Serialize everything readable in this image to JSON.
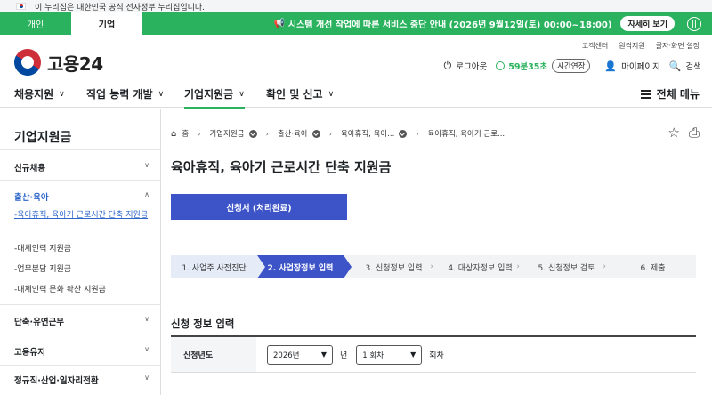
{
  "gov_banner": {
    "text": "이 누리집은 대한민국 공식 전자정부 누리집입니다."
  },
  "user_tabs": [
    {
      "label": "개인",
      "active": false
    },
    {
      "label": "기업",
      "active": true
    }
  ],
  "notice": {
    "text": "시스템 개선 작업에 따른 서비스 중단 안내 (2026년 9월12일(토) 00:00~18:00)",
    "detail_label": "자세히 보기",
    "icon": "megaphone-icon"
  },
  "util_links": [
    "고객센터",
    "원격지원",
    "글자·화면 설정"
  ],
  "logo": {
    "text": "고용24"
  },
  "header": {
    "logout": "로그아웃",
    "timer": "59분35초",
    "extend": "시간연장",
    "mypage": "마이페이지",
    "search": "검색"
  },
  "main_nav": [
    {
      "label": "채용지원",
      "active": false
    },
    {
      "label": "직업 능력 개발",
      "active": false
    },
    {
      "label": "기업지원금",
      "active": true
    },
    {
      "label": "확인 및 신고",
      "active": false
    }
  ],
  "all_menu": "전체 메뉴",
  "sidebar": {
    "title": "기업지원금",
    "sections": [
      {
        "label": "신규채용"
      },
      {
        "label": "출산·육아"
      },
      {
        "label": "단축·유연근무"
      },
      {
        "label": "고용유지"
      },
      {
        "label": "정규직·산업·일자리전환"
      }
    ],
    "sub_items": [
      "-육아휴직, 육아기 근로시간 단축 지원금",
      "-대체인력 지원금",
      "-업무분담 지원금",
      "-대체인력 문화 확산 지원금"
    ]
  },
  "breadcrumb": [
    "홈",
    "기업지원금",
    "출산·육아",
    "육아휴직, 육아...",
    "육아휴직, 육아기 근로..."
  ],
  "page_title": "육아휴직, 육아기 근로시간 단축 지원금",
  "apply_button": "신청서 (처리완료)",
  "steps": [
    "1. 사업주 사전진단",
    "2. 사업장정보 입력",
    "3. 신청정보 입력",
    "4. 대상자정보 입력",
    "5. 신청정보 검토",
    "6. 제출"
  ],
  "section_title": "신청 정보 입력",
  "form": {
    "label": "신청년도",
    "year_value": "2026년",
    "year_unit": "년",
    "round_value": "1 회차",
    "round_unit": "회차"
  }
}
